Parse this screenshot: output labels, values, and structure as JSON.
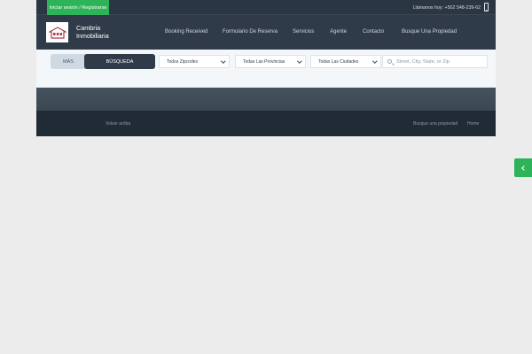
{
  "topbar": {
    "login_label": "Iniciar sesión / Registrarse",
    "phone_text": "Llámanos hoy: +502 548-239-62"
  },
  "header": {
    "brand_line1": "Cambria",
    "brand_line2": "Inmobiliaria",
    "nav": [
      "Booking Received",
      "Formulario De Reserva",
      "Servicios",
      "Agente",
      "Contacto",
      "Busque Una Propiedad"
    ]
  },
  "search": {
    "more_label": "MÁS",
    "search_label": "BÚSQUEDA",
    "selects": [
      "Todos Zipcodes",
      "Todas Las Provincias",
      "Todas Las Ciudades"
    ],
    "placeholder": "Street, City, State, or Zip"
  },
  "footer": {
    "back_top": "Volver arriba",
    "links": [
      "Busque una propiedad",
      "Home"
    ]
  },
  "colors": {
    "accent_green": "#2db459",
    "header_dark": "#2f3b48",
    "footer_dark": "#212b35"
  }
}
